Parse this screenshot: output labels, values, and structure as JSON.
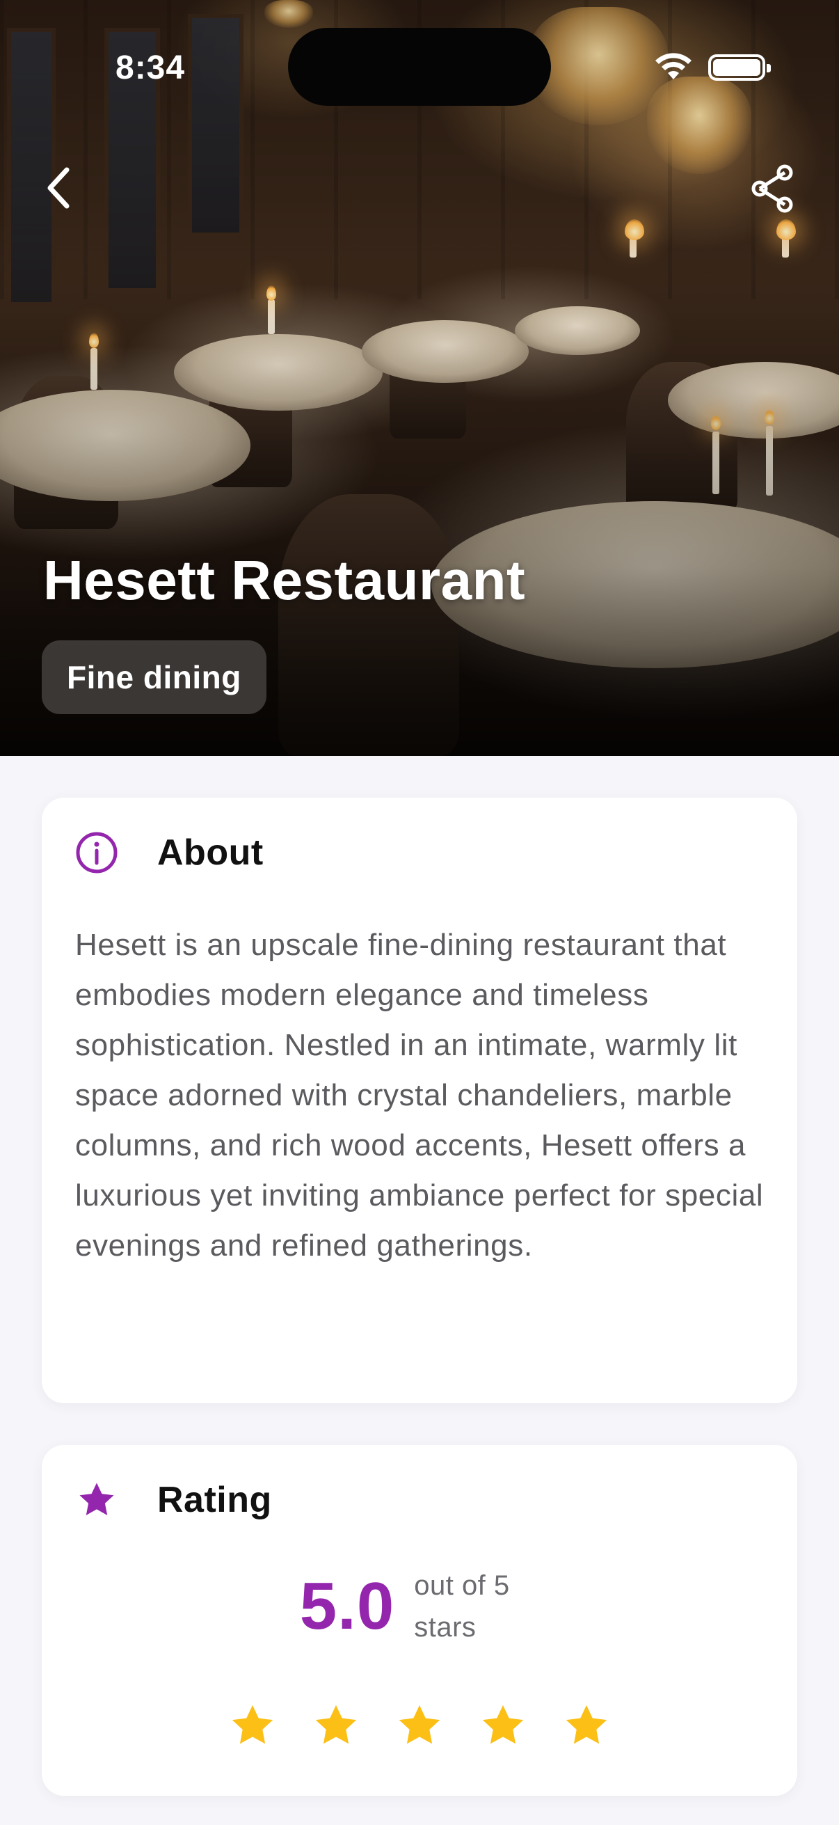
{
  "status_bar": {
    "time": "8:34"
  },
  "restaurant": {
    "name": "Hesett Restaurant",
    "category": "Fine dining"
  },
  "about": {
    "title": "About",
    "text": "Hesett is an upscale fine-dining restaurant that embodies modern elegance and timeless sophistication. Nestled in an intimate, warmly lit space adorned with crystal chandeliers, marble columns, and rich wood accents, Hesett offers a luxurious yet inviting ambiance perfect for special evenings and refined gatherings."
  },
  "rating": {
    "title": "Rating",
    "value": "5.0",
    "scale_text": "out of 5 stars",
    "stars_filled": 5,
    "stars_total": 5
  },
  "colors": {
    "accent": "#9326ad",
    "star": "#fbbf16",
    "background": "#f6f6fa",
    "card": "#ffffff"
  },
  "icons": {
    "back": "chevron-left-icon",
    "share": "share-icon",
    "about": "info-icon",
    "rating": "star-icon"
  }
}
